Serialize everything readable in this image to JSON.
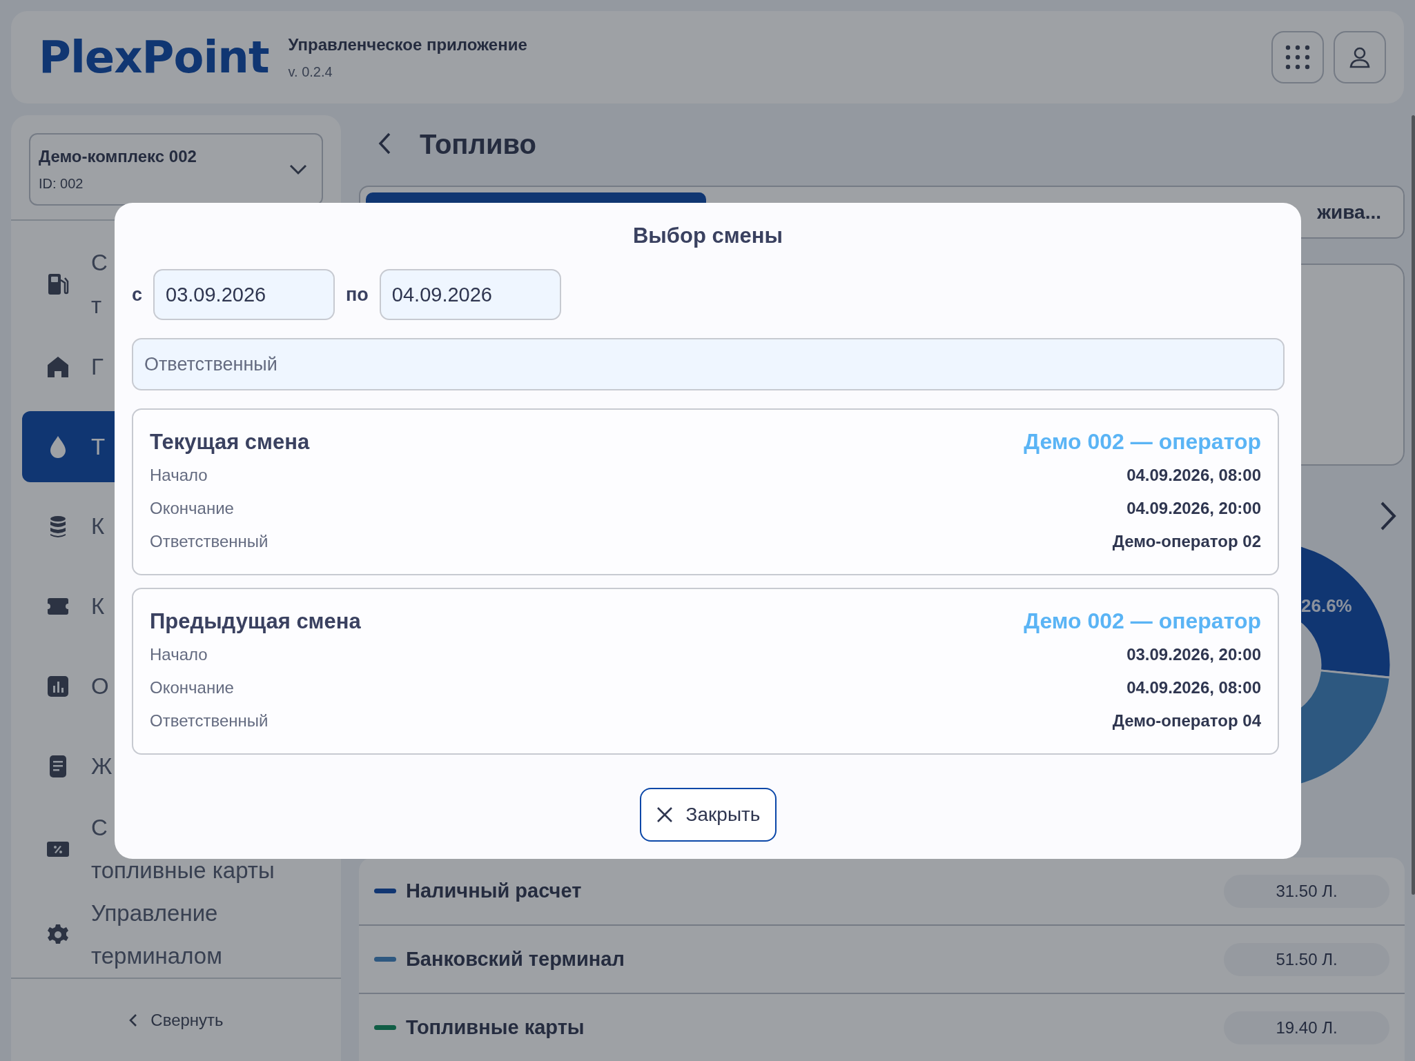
{
  "header": {
    "logo": "PlexPoint",
    "app_name": "Управленческое приложение",
    "version": "v. 0.2.4"
  },
  "sidebar": {
    "complex": {
      "name": "Демо-комплекс 002",
      "id": "ID: 002"
    },
    "items": [
      {
        "lines": [
          "С",
          "т"
        ],
        "selected": false
      },
      {
        "lines": [
          "Г"
        ],
        "selected": false
      },
      {
        "lines": [
          "Т"
        ],
        "selected": true
      },
      {
        "lines": [
          "К"
        ],
        "selected": false
      },
      {
        "lines": [
          "К"
        ],
        "selected": false
      },
      {
        "lines": [
          "О"
        ],
        "selected": false
      },
      {
        "lines": [
          "Ж"
        ],
        "selected": false
      },
      {
        "lines": [
          "С",
          "топливные карты"
        ],
        "selected": false
      },
      {
        "lines": [
          "Управление",
          "терминалом"
        ],
        "selected": false
      }
    ],
    "collapse": "Свернуть"
  },
  "main": {
    "title": "Топливо",
    "tabs": [
      {
        "selected": true
      },
      {
        "label": "жива...",
        "selected": false
      }
    ],
    "slice_label": "26.6%",
    "legend": [
      {
        "label": "Наличный расчет",
        "value": "31.50 Л.",
        "color": "#113672"
      },
      {
        "label": "Банковский терминал",
        "value": "51.50 Л.",
        "color": "#2e5880"
      },
      {
        "label": "Топливные карты",
        "value": "19.40 Л.",
        "color": "#105d45"
      }
    ]
  },
  "dialog": {
    "title": "Выбор смены",
    "from_label": "с",
    "from": "03.09.2026",
    "to_label": "по",
    "to": "04.09.2026",
    "responsible_placeholder": "Ответственный",
    "shifts": [
      {
        "title": "Текущая смена",
        "operator": "Демо 002 — оператор",
        "rows": [
          {
            "label": "Начало",
            "value": "04.09.2026, 08:00"
          },
          {
            "label": "Окончание",
            "value": "04.09.2026, 20:00"
          },
          {
            "label": "Ответственный",
            "value": "Демо-оператор 02"
          }
        ]
      },
      {
        "title": "Предыдущая смена",
        "operator": "Демо 002 — оператор",
        "rows": [
          {
            "label": "Начало",
            "value": "03.09.2026, 20:00"
          },
          {
            "label": "Окончание",
            "value": "04.09.2026, 08:00"
          },
          {
            "label": "Ответственный",
            "value": "Демо-оператор 04"
          }
        ]
      }
    ],
    "close": "Закрыть"
  }
}
